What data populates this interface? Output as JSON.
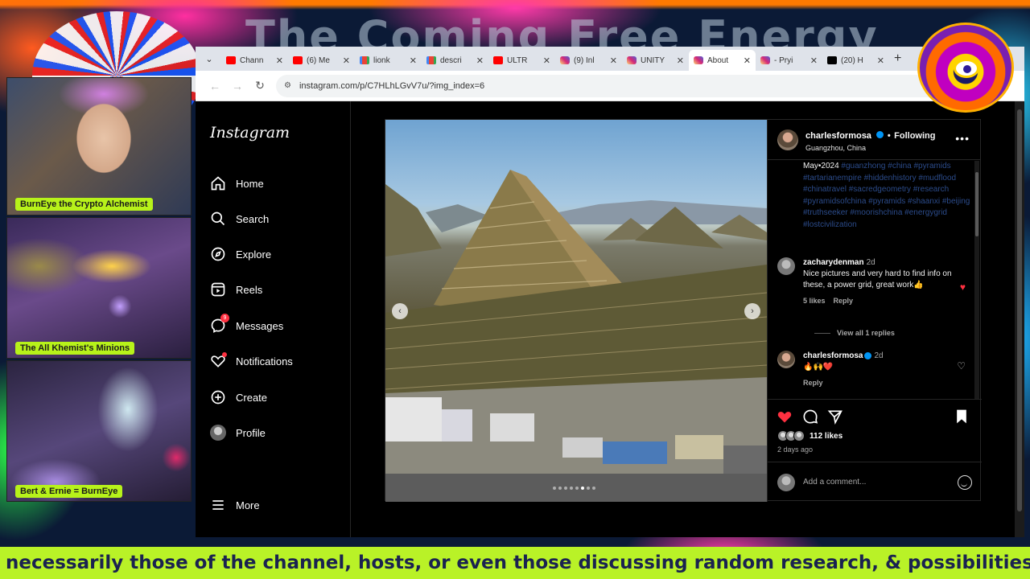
{
  "stream": {
    "banner_title": "The Coming Free Energy",
    "cams": [
      {
        "label": "BurnEye the Crypto Alchemist"
      },
      {
        "label": "The All Khemist's Minions"
      },
      {
        "label": "Bert & Ernie = BurnEye"
      }
    ],
    "ticker": "t necessarily those of the channel, hosts, or even those discussing random research, & possibilities. No hate"
  },
  "browser": {
    "tabs": [
      {
        "label": "Chann",
        "icon": "youtube-icon"
      },
      {
        "label": "(6) Me",
        "icon": "youtube-icon"
      },
      {
        "label": "lionk",
        "icon": "gmail-icon"
      },
      {
        "label": "descri",
        "icon": "gmail-icon"
      },
      {
        "label": "ULTR",
        "icon": "youtube-icon"
      },
      {
        "label": "(9) Inl",
        "icon": "instagram-icon"
      },
      {
        "label": "UNITY",
        "icon": "instagram-icon"
      },
      {
        "label": "About",
        "icon": "instagram-icon",
        "active": true
      },
      {
        "label": "- Pryi",
        "icon": "instagram-icon"
      },
      {
        "label": "(20) H",
        "icon": "x-icon"
      }
    ],
    "url": "instagram.com/p/C7HLhLGvV7u/?img_index=6"
  },
  "instagram": {
    "logo": "Instagram",
    "nav": [
      {
        "label": "Home",
        "icon": "home-icon"
      },
      {
        "label": "Search",
        "icon": "search-icon"
      },
      {
        "label": "Explore",
        "icon": "compass-icon"
      },
      {
        "label": "Reels",
        "icon": "reels-icon"
      },
      {
        "label": "Messages",
        "icon": "messenger-icon",
        "badge": "9"
      },
      {
        "label": "Notifications",
        "icon": "heart-icon"
      },
      {
        "label": "Create",
        "icon": "plus-icon"
      },
      {
        "label": "Profile",
        "icon": "avatar"
      }
    ],
    "more_label": "More",
    "post": {
      "username": "charlesformosa",
      "follow_sep": "•",
      "following": "Following",
      "location": "Guangzhou, China",
      "caption_lead": "May•2024",
      "caption_tags": "#guanzhong #china #pyramids #tartarianempire #hiddenhistory #mudflood #chinatravel #sacredgeometry #research #pyramidsofchina #pyramids #shaanxi #beijing #truthseeker #moorishchina #energygrid #lostcivilization",
      "comments": [
        {
          "username": "zacharydenman",
          "time": "2d",
          "text": "Nice pictures and very hard to find info on these, a power grid, great work👍",
          "likes": "5 likes",
          "reply": "Reply",
          "liked": true,
          "view_replies": "View all 1 replies"
        },
        {
          "username": "charlesformosa",
          "time": "2d",
          "text": "🔥🙌❤️",
          "reply": "Reply",
          "liked": false
        }
      ],
      "likes": "112 likes",
      "time": "2 days ago",
      "add_comment_placeholder": "Add a comment...",
      "carousel_index": 6,
      "carousel_count": 8
    }
  },
  "colors": {
    "ig_bg": "#000000",
    "ticker_bg": "#b9f227",
    "cam_label_bg": "#b7f21a",
    "like_red": "#ff3040",
    "verified_blue": "#0095f6"
  }
}
